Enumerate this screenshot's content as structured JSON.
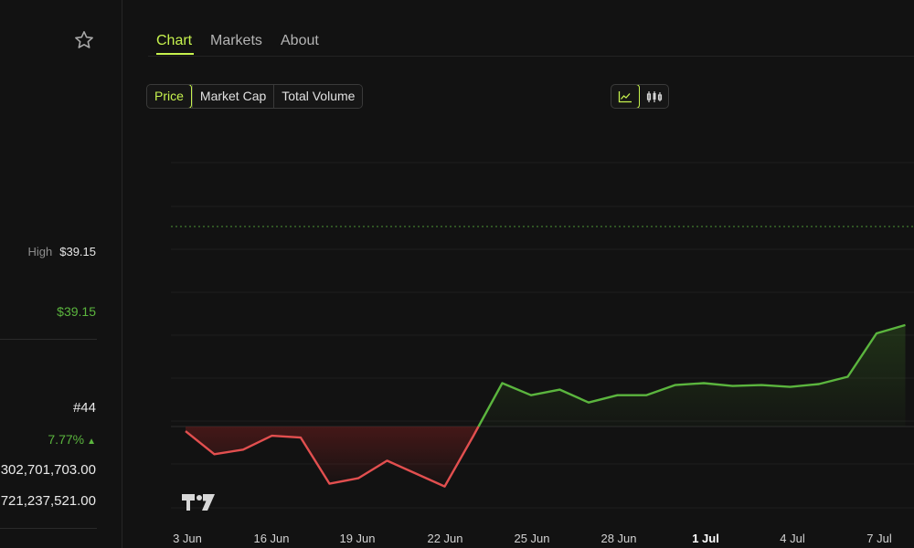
{
  "left": {
    "high_label": "High",
    "high_value": "$39.15",
    "price_value": "$39.15",
    "rank": "#44",
    "change_pct": "7.77%",
    "change_arrow": "▲",
    "value1": "302,701,703.00",
    "value2": "721,237,521.00"
  },
  "tabs": [
    "Chart",
    "Markets",
    "About"
  ],
  "segments": [
    "Price",
    "Market Cap",
    "Total Volume"
  ],
  "colors": {
    "accent": "#c6f24e",
    "up": "#5bb53e",
    "down": "#e24f4f",
    "background": "#121212"
  },
  "icons": {
    "favorite": "star-icon",
    "line_chart": "line-chart-icon",
    "candles": "candlestick-icon",
    "brand": "tradingview-logo"
  },
  "chart_data": {
    "type": "line",
    "x_ticks": [
      "3 Jun",
      "16 Jun",
      "19 Jun",
      "22 Jun",
      "25 Jun",
      "28 Jun",
      "1 Jul",
      "4 Jul",
      "7 Jul"
    ],
    "bold_tick": "1 Jul",
    "baseline_value": 0,
    "high_line": "dotted",
    "points": [
      [
        0,
        -0.5
      ],
      [
        1,
        -3.0
      ],
      [
        2,
        -2.5
      ],
      [
        3,
        -1.0
      ],
      [
        4,
        -1.2
      ],
      [
        5,
        -6.2
      ],
      [
        6,
        -5.6
      ],
      [
        7,
        -3.7
      ],
      [
        8,
        -5.1
      ],
      [
        9,
        -6.5
      ],
      [
        10,
        -1.0
      ],
      [
        11,
        4.7
      ],
      [
        12,
        3.4
      ],
      [
        13,
        4.0
      ],
      [
        14,
        2.6
      ],
      [
        15,
        3.4
      ],
      [
        16,
        3.4
      ],
      [
        17,
        4.5
      ],
      [
        18,
        4.7
      ],
      [
        19,
        4.4
      ],
      [
        20,
        4.5
      ],
      [
        21,
        4.3
      ],
      [
        22,
        4.6
      ],
      [
        23,
        5.4
      ],
      [
        24,
        10.1
      ],
      [
        25,
        11.0
      ]
    ],
    "grid": true
  }
}
